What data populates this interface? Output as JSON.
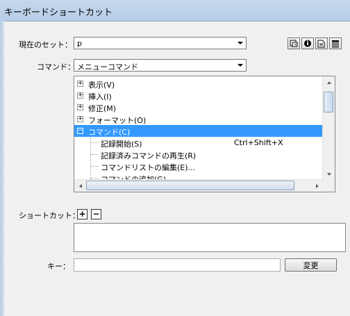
{
  "window": {
    "title": "キーボードショートカット"
  },
  "set": {
    "label": "現在のセット：",
    "value": "p"
  },
  "toolbar": {
    "buttons": [
      {
        "name": "duplicate-set-button",
        "icon": "duplicate-icon"
      },
      {
        "name": "rename-set-button",
        "icon": "info-icon"
      },
      {
        "name": "export-set-button",
        "icon": "export-icon"
      },
      {
        "name": "delete-set-button",
        "icon": "trash-icon"
      }
    ]
  },
  "commands": {
    "label": "コマンド：",
    "value": "メニューコマンド",
    "tree": [
      {
        "text": "表示(V)",
        "expander": "+",
        "level": 0
      },
      {
        "text": "挿入(I)",
        "expander": "+",
        "level": 0
      },
      {
        "text": "修正(M)",
        "expander": "+",
        "level": 0
      },
      {
        "text": "フォーマット(O)",
        "expander": "+",
        "level": 0
      },
      {
        "text": "コマンド(C)",
        "expander": "−",
        "level": 0,
        "selected": true
      },
      {
        "text": "記録開始(S)",
        "shortcut": "Ctrl+Shift+X",
        "level": 1
      },
      {
        "text": "記録済みコマンドの再生(R)",
        "level": 1
      },
      {
        "text": "コマンドリストの編集(E)...",
        "level": 1
      },
      {
        "text": "コマンドの追加(G)...",
        "level": 1
      }
    ]
  },
  "shortcut": {
    "label": "ショートカット：",
    "add": "+",
    "remove": "−"
  },
  "key": {
    "label": "キー：",
    "value": "",
    "button": "変更"
  },
  "colors": {
    "selection": "#3399ff",
    "titlebar": "#bcd2e8"
  }
}
